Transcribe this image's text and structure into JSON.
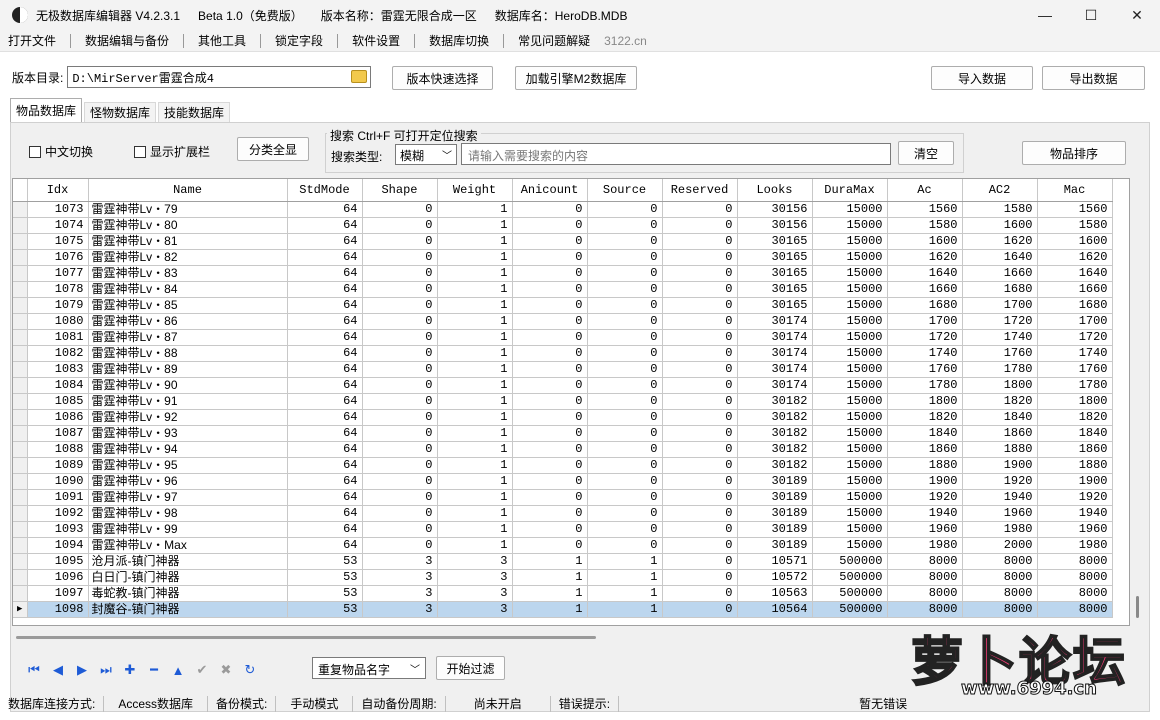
{
  "titlebar": {
    "app_title": "无极数据库编辑器 V4.2.3.1",
    "edition": "Beta 1.0（免费版）",
    "version_name": "版本名称：雷霆无限合成一区",
    "db_name": "数据库名：HeroDB.MDB",
    "minimize": "—",
    "maximize": "☐",
    "close": "✕"
  },
  "menu": {
    "items": [
      "打开文件",
      "数据编辑与备份",
      "其他工具",
      "锁定字段",
      "软件设置",
      "数据库切换",
      "常见问题解疑"
    ],
    "extra": "3122.cn"
  },
  "dir": {
    "label": "版本目录:",
    "value": "D:\\MirServer雷霆合成4",
    "quick_select": "版本快速选择",
    "load_engine": "加载引擎M2数据库",
    "import": "导入数据",
    "export": "导出数据"
  },
  "tabs": [
    "物品数据库",
    "怪物数据库",
    "技能数据库"
  ],
  "toolbar": {
    "chinese_toggle": "中文切换",
    "show_ext": "显示扩展栏",
    "show_all": "分类全显",
    "search_title": "搜索  Ctrl+F 可打开定位搜索",
    "search_type_label": "搜索类型:",
    "search_type_value": "模糊",
    "search_placeholder": "请输入需要搜索的内容",
    "clear": "清空",
    "sort": "物品排序"
  },
  "table": {
    "columns": [
      "Idx",
      "Name",
      "StdMode",
      "Shape",
      "Weight",
      "Anicount",
      "Source",
      "Reserved",
      "Looks",
      "DuraMax",
      "Ac",
      "AC2",
      "Mac"
    ],
    "rows": [
      [
        "1073",
        "雷霆神带Lv・79",
        "64",
        "0",
        "1",
        "0",
        "0",
        "0",
        "30156",
        "15000",
        "1560",
        "1580",
        "1560"
      ],
      [
        "1074",
        "雷霆神带Lv・80",
        "64",
        "0",
        "1",
        "0",
        "0",
        "0",
        "30156",
        "15000",
        "1580",
        "1600",
        "1580"
      ],
      [
        "1075",
        "雷霆神带Lv・81",
        "64",
        "0",
        "1",
        "0",
        "0",
        "0",
        "30165",
        "15000",
        "1600",
        "1620",
        "1600"
      ],
      [
        "1076",
        "雷霆神带Lv・82",
        "64",
        "0",
        "1",
        "0",
        "0",
        "0",
        "30165",
        "15000",
        "1620",
        "1640",
        "1620"
      ],
      [
        "1077",
        "雷霆神带Lv・83",
        "64",
        "0",
        "1",
        "0",
        "0",
        "0",
        "30165",
        "15000",
        "1640",
        "1660",
        "1640"
      ],
      [
        "1078",
        "雷霆神带Lv・84",
        "64",
        "0",
        "1",
        "0",
        "0",
        "0",
        "30165",
        "15000",
        "1660",
        "1680",
        "1660"
      ],
      [
        "1079",
        "雷霆神带Lv・85",
        "64",
        "0",
        "1",
        "0",
        "0",
        "0",
        "30165",
        "15000",
        "1680",
        "1700",
        "1680"
      ],
      [
        "1080",
        "雷霆神带Lv・86",
        "64",
        "0",
        "1",
        "0",
        "0",
        "0",
        "30174",
        "15000",
        "1700",
        "1720",
        "1700"
      ],
      [
        "1081",
        "雷霆神带Lv・87",
        "64",
        "0",
        "1",
        "0",
        "0",
        "0",
        "30174",
        "15000",
        "1720",
        "1740",
        "1720"
      ],
      [
        "1082",
        "雷霆神带Lv・88",
        "64",
        "0",
        "1",
        "0",
        "0",
        "0",
        "30174",
        "15000",
        "1740",
        "1760",
        "1740"
      ],
      [
        "1083",
        "雷霆神带Lv・89",
        "64",
        "0",
        "1",
        "0",
        "0",
        "0",
        "30174",
        "15000",
        "1760",
        "1780",
        "1760"
      ],
      [
        "1084",
        "雷霆神带Lv・90",
        "64",
        "0",
        "1",
        "0",
        "0",
        "0",
        "30174",
        "15000",
        "1780",
        "1800",
        "1780"
      ],
      [
        "1085",
        "雷霆神带Lv・91",
        "64",
        "0",
        "1",
        "0",
        "0",
        "0",
        "30182",
        "15000",
        "1800",
        "1820",
        "1800"
      ],
      [
        "1086",
        "雷霆神带Lv・92",
        "64",
        "0",
        "1",
        "0",
        "0",
        "0",
        "30182",
        "15000",
        "1820",
        "1840",
        "1820"
      ],
      [
        "1087",
        "雷霆神带Lv・93",
        "64",
        "0",
        "1",
        "0",
        "0",
        "0",
        "30182",
        "15000",
        "1840",
        "1860",
        "1840"
      ],
      [
        "1088",
        "雷霆神带Lv・94",
        "64",
        "0",
        "1",
        "0",
        "0",
        "0",
        "30182",
        "15000",
        "1860",
        "1880",
        "1860"
      ],
      [
        "1089",
        "雷霆神带Lv・95",
        "64",
        "0",
        "1",
        "0",
        "0",
        "0",
        "30182",
        "15000",
        "1880",
        "1900",
        "1880"
      ],
      [
        "1090",
        "雷霆神带Lv・96",
        "64",
        "0",
        "1",
        "0",
        "0",
        "0",
        "30189",
        "15000",
        "1900",
        "1920",
        "1900"
      ],
      [
        "1091",
        "雷霆神带Lv・97",
        "64",
        "0",
        "1",
        "0",
        "0",
        "0",
        "30189",
        "15000",
        "1920",
        "1940",
        "1920"
      ],
      [
        "1092",
        "雷霆神带Lv・98",
        "64",
        "0",
        "1",
        "0",
        "0",
        "0",
        "30189",
        "15000",
        "1940",
        "1960",
        "1940"
      ],
      [
        "1093",
        "雷霆神带Lv・99",
        "64",
        "0",
        "1",
        "0",
        "0",
        "0",
        "30189",
        "15000",
        "1960",
        "1980",
        "1960"
      ],
      [
        "1094",
        "雷霆神带Lv・Max",
        "64",
        "0",
        "1",
        "0",
        "0",
        "0",
        "30189",
        "15000",
        "1980",
        "2000",
        "1980"
      ],
      [
        "1095",
        "沧月派-镇门神器",
        "53",
        "3",
        "3",
        "1",
        "1",
        "0",
        "10571",
        "500000",
        "8000",
        "8000",
        "8000"
      ],
      [
        "1096",
        "白日门-镇门神器",
        "53",
        "3",
        "3",
        "1",
        "1",
        "0",
        "10572",
        "500000",
        "8000",
        "8000",
        "8000"
      ],
      [
        "1097",
        "毒蛇教-镇门神器",
        "53",
        "3",
        "3",
        "1",
        "1",
        "0",
        "10563",
        "500000",
        "8000",
        "8000",
        "8000"
      ],
      [
        "1098",
        "封魔谷-镇门神器",
        "53",
        "3",
        "3",
        "1",
        "1",
        "0",
        "10564",
        "500000",
        "8000",
        "8000",
        "8000"
      ]
    ],
    "selected_index": 25
  },
  "bottom": {
    "dup_select": "重复物品名字",
    "filter": "开始过滤"
  },
  "status": {
    "conn_label": "数据库连接方式:",
    "conn_value": "Access数据库",
    "backup_label": "备份模式:",
    "backup_value": "手动模式",
    "auto_label": "自动备份周期:",
    "auto_value": "尚未开启",
    "error_label": "错误提示:",
    "error_value": "暂无错误"
  },
  "logo": {
    "text": "萝卜论坛",
    "url": "www.6994.cn"
  },
  "colors": {
    "selection": "#bcd6ee",
    "nav_blue": "#1e5bd6",
    "logo_pink": "#ff3c7a"
  }
}
